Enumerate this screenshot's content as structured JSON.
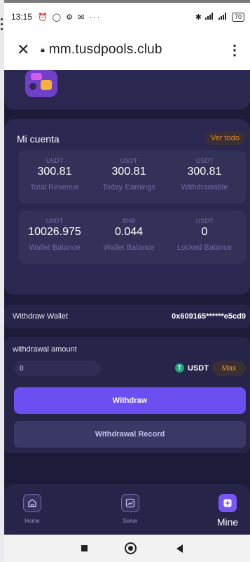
{
  "status_bar": {
    "time": "13:15",
    "notification_icons": "⏰ ◯ ⚙ ✉ ···",
    "battery": "70"
  },
  "browser": {
    "url": "mm.tusdpools.club",
    "close_icon": "close-icon",
    "menu_icon": "kebab-menu-icon"
  },
  "account": {
    "title": "Mi cuenta",
    "view_all": "Ver todo",
    "stats_row1": [
      {
        "unit": "USDT",
        "value": "300.81",
        "label": "Total Revenue"
      },
      {
        "unit": "USDT",
        "value": "300.81",
        "label": "Today Earnings"
      },
      {
        "unit": "USDT",
        "value": "300.81",
        "label": "Withdrawable"
      }
    ],
    "stats_row2": [
      {
        "unit": "USDT",
        "value": "10026.975",
        "label": "Wallet Balance"
      },
      {
        "unit": "BNB",
        "value": "0.044",
        "label": "Wallet Balance"
      },
      {
        "unit": "USDT",
        "value": "0",
        "label": "Locked Balance"
      }
    ]
  },
  "withdraw_wallet": {
    "label": "Withdraw Wallet",
    "address": "0x609165******e5cd9"
  },
  "withdrawal": {
    "label": "withdrawal amount",
    "amount_value": "0",
    "currency": "USDT",
    "currency_icon_glyph": "T",
    "max_label": "Max",
    "withdraw_button": "Withdraw",
    "record_button": "Withdrawal Record"
  },
  "bottom_nav": {
    "items": [
      {
        "label": "Home",
        "icon": "home-icon"
      },
      {
        "label": "Serve",
        "icon": "chart-icon"
      },
      {
        "label": "Mine",
        "icon": "plus-icon"
      }
    ]
  },
  "colors": {
    "app_bg": "#1d1b3a",
    "card_bg": "#2a2850",
    "accent": "#6c4ff0",
    "orange": "#e88a2a",
    "tether": "#26a17b"
  }
}
